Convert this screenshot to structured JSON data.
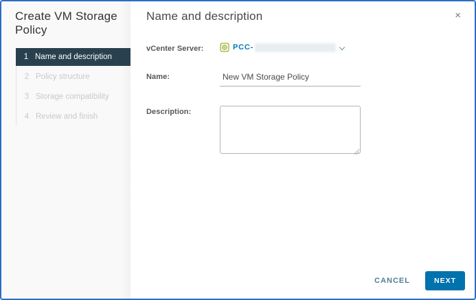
{
  "dialog": {
    "title": "Create VM Storage Policy",
    "close_icon": "×"
  },
  "steps": [
    {
      "number": "1",
      "label": "Name and description",
      "active": true
    },
    {
      "number": "2",
      "label": "Policy structure",
      "active": false
    },
    {
      "number": "3",
      "label": "Storage compatibility",
      "active": false
    },
    {
      "number": "4",
      "label": "Review and finish",
      "active": false
    }
  ],
  "main": {
    "heading": "Name and description",
    "fields": {
      "vcenter": {
        "label": "vCenter Server:",
        "value": "PCC-",
        "value_redacted": true,
        "icon": "vcenter-server-icon"
      },
      "name": {
        "label": "Name:",
        "value": "New VM Storage Policy"
      },
      "description": {
        "label": "Description:",
        "value": ""
      }
    }
  },
  "footer": {
    "cancel_label": "CANCEL",
    "next_label": "NEXT"
  },
  "colors": {
    "accent_link": "#0079b8",
    "primary_button": "#0072ad",
    "active_step_bg": "#29414e",
    "dialog_border": "#2b6cc3",
    "sidebar_bg": "#f9f9f9",
    "inactive_step_text": "#c9c9c9"
  }
}
